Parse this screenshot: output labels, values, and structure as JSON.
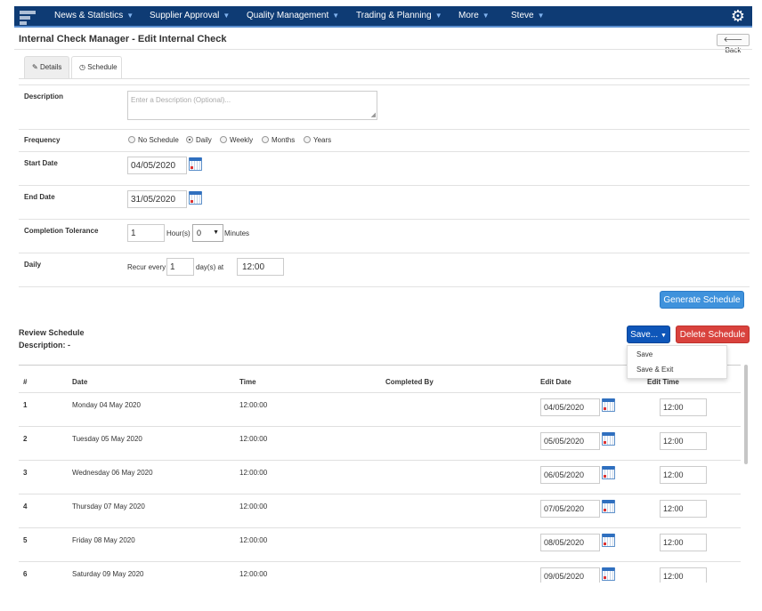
{
  "nav": {
    "items": [
      "News & Statistics",
      "Supplier Approval",
      "Quality Management",
      "Trading & Planning",
      "More",
      "Steve"
    ]
  },
  "header": {
    "title": "Internal Check Manager - Edit Internal Check",
    "back_label": "Back"
  },
  "tabs": [
    "Details",
    "Schedule"
  ],
  "form": {
    "description_label": "Description",
    "description_placeholder": "Enter a Description (Optional)...",
    "frequency_label": "Frequency",
    "frequency_options": [
      "No Schedule",
      "Daily",
      "Weekly",
      "Months",
      "Years"
    ],
    "frequency_selected": "Daily",
    "start_date_label": "Start Date",
    "start_date": "04/05/2020",
    "end_date_label": "End Date",
    "end_date": "31/05/2020",
    "tolerance_label": "Completion Tolerance",
    "tolerance_hours": "1",
    "hours_unit": "Hour(s)",
    "tolerance_minutes": "0",
    "minutes_unit": "Minutes",
    "daily_label": "Daily",
    "recur_every_label": "Recur every",
    "recur_every": "1",
    "days_at_label": "day(s) at",
    "recur_time": "12:00"
  },
  "buttons": {
    "generate": "Generate Schedule",
    "save": "Save...",
    "delete": "Delete Schedule"
  },
  "save_menu": [
    "Save",
    "Save & Exit"
  ],
  "review": {
    "title": "Review Schedule",
    "description_label": "Description: -"
  },
  "table": {
    "headers": [
      "#",
      "Date",
      "Time",
      "Completed By",
      "Edit Date",
      "Edit Time"
    ],
    "rows": [
      {
        "num": "1",
        "date": "Monday 04 May 2020",
        "time": "12:00:00",
        "completed_by": "",
        "edit_date": "04/05/2020",
        "edit_time": "12:00"
      },
      {
        "num": "2",
        "date": "Tuesday 05 May 2020",
        "time": "12:00:00",
        "completed_by": "",
        "edit_date": "05/05/2020",
        "edit_time": "12:00"
      },
      {
        "num": "3",
        "date": "Wednesday 06 May 2020",
        "time": "12:00:00",
        "completed_by": "",
        "edit_date": "06/05/2020",
        "edit_time": "12:00"
      },
      {
        "num": "4",
        "date": "Thursday 07 May 2020",
        "time": "12:00:00",
        "completed_by": "",
        "edit_date": "07/05/2020",
        "edit_time": "12:00"
      },
      {
        "num": "5",
        "date": "Friday 08 May 2020",
        "time": "12:00:00",
        "completed_by": "",
        "edit_date": "08/05/2020",
        "edit_time": "12:00"
      },
      {
        "num": "6",
        "date": "Saturday 09 May 2020",
        "time": "12:00:00",
        "completed_by": "",
        "edit_date": "09/05/2020",
        "edit_time": "12:00"
      }
    ]
  },
  "colors": {
    "nav_bg": "#0e3b74",
    "primary": "#0e56b9",
    "info": "#3f92dc",
    "danger": "#d9423d"
  }
}
